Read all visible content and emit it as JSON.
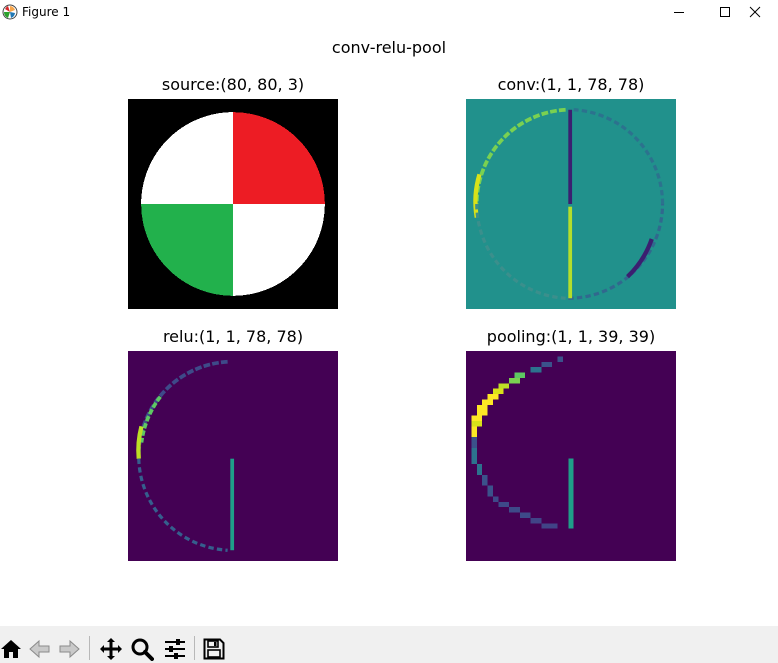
{
  "window": {
    "title": "Figure 1",
    "controls": [
      "minimize",
      "maximize",
      "close"
    ]
  },
  "figure": {
    "suptitle": "conv-relu-pool",
    "subplots": [
      {
        "title": "source:(80, 80, 3)",
        "kind": "image",
        "colormap": "rgb"
      },
      {
        "title": "conv:(1, 1, 78, 78)",
        "kind": "image",
        "colormap": "viridis"
      },
      {
        "title": "relu:(1, 1, 78, 78)",
        "kind": "image",
        "colormap": "viridis"
      },
      {
        "title": "pooling:(1, 1, 39, 39)",
        "kind": "image",
        "colormap": "viridis"
      }
    ]
  },
  "toolbar": {
    "buttons": [
      {
        "name": "home",
        "icon": "home-icon"
      },
      {
        "name": "back",
        "icon": "back-arrow-icon"
      },
      {
        "name": "forward",
        "icon": "forward-arrow-icon"
      },
      {
        "name": "pan",
        "icon": "move-icon"
      },
      {
        "name": "zoom",
        "icon": "magnifier-icon"
      },
      {
        "name": "configure-subplots",
        "icon": "sliders-icon"
      },
      {
        "name": "save",
        "icon": "floppy-disk-icon"
      }
    ]
  },
  "colors": {
    "image_background": "#000000",
    "quadrant_white": "#ffffff",
    "quadrant_red": "#ed1c24",
    "quadrant_green": "#22b14c",
    "viridis_bg_conv": "#21918c",
    "viridis_bg_relu": "#440154",
    "viridis_high": "#fde725",
    "viridis_low": "#3b1f70"
  }
}
